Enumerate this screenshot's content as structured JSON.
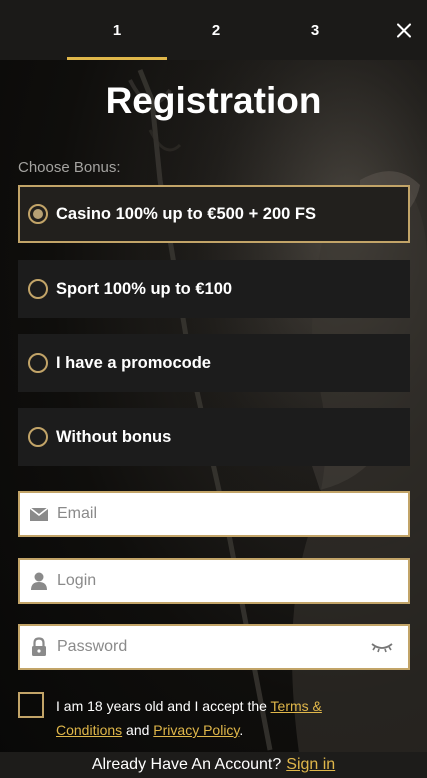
{
  "steps": {
    "items": [
      {
        "label": "1"
      },
      {
        "label": "2"
      },
      {
        "label": "3"
      }
    ],
    "active_index": 0
  },
  "title": "Registration",
  "bonus": {
    "label": "Choose Bonus:",
    "options": [
      {
        "label": "Casino 100% up to €500 + 200 FS",
        "selected": true
      },
      {
        "label": "Sport 100% up to €100",
        "selected": false
      },
      {
        "label": "I have a promocode",
        "selected": false
      },
      {
        "label": "Without bonus",
        "selected": false
      }
    ]
  },
  "form": {
    "email": {
      "placeholder": "Email",
      "value": "",
      "icon": "envelope-icon"
    },
    "login": {
      "placeholder": "Login",
      "value": "",
      "icon": "user-icon"
    },
    "password": {
      "placeholder": "Password",
      "value": "",
      "icon": "lock-icon",
      "toggle_icon": "eye-closed-icon"
    }
  },
  "accept": {
    "text_before": "I am 18 years old and I accept the ",
    "terms_link": "Terms & Conditions",
    "text_and": " and ",
    "privacy_link": "Privacy Policy",
    "text_after": ".",
    "checked": false
  },
  "footer": {
    "text": "Already Have An Account?",
    "link": "Sign in"
  },
  "colors": {
    "accent": "#e0b74a",
    "border_gold": "#c2a468",
    "background": "#0d0c0a",
    "option_bg": "#1c1c1c"
  }
}
